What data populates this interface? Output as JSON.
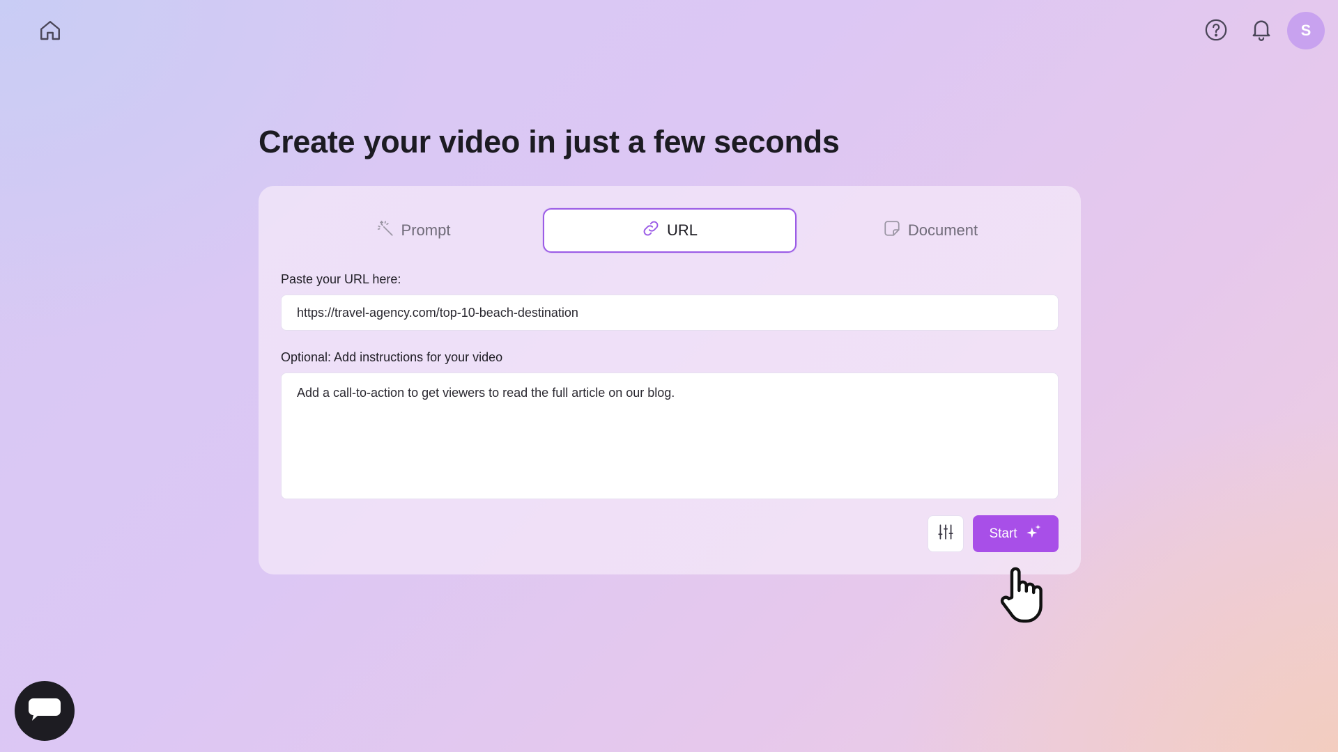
{
  "header": {
    "home_icon": "home-icon",
    "help_icon": "help-circle-icon",
    "notifications_icon": "bell-icon",
    "avatar_initial": "S"
  },
  "main": {
    "title": "Create your video in just a few seconds",
    "tabs": [
      {
        "label": "Prompt",
        "icon": "magic-wand-icon",
        "active": false
      },
      {
        "label": "URL",
        "icon": "link-icon",
        "active": true
      },
      {
        "label": "Document",
        "icon": "document-icon",
        "active": false
      }
    ],
    "url_field": {
      "label": "Paste your URL here:",
      "value": "https://travel-agency.com/top-10-beach-destination"
    },
    "instructions_field": {
      "label": "Optional: Add instructions for your video",
      "value": "Add a call-to-action to get viewers to read the full article on our blog."
    },
    "settings_icon": "sliders-icon",
    "start_button": {
      "label": "Start",
      "icon": "sparkles-icon"
    }
  },
  "chat_widget": {
    "icon": "chat-bubble-icon"
  },
  "colors": {
    "accent": "#a84fe8",
    "active_tab_border": "#9b5ce6",
    "avatar_bg": "#c8a2ef",
    "chat_button_bg": "#1d1c22"
  }
}
